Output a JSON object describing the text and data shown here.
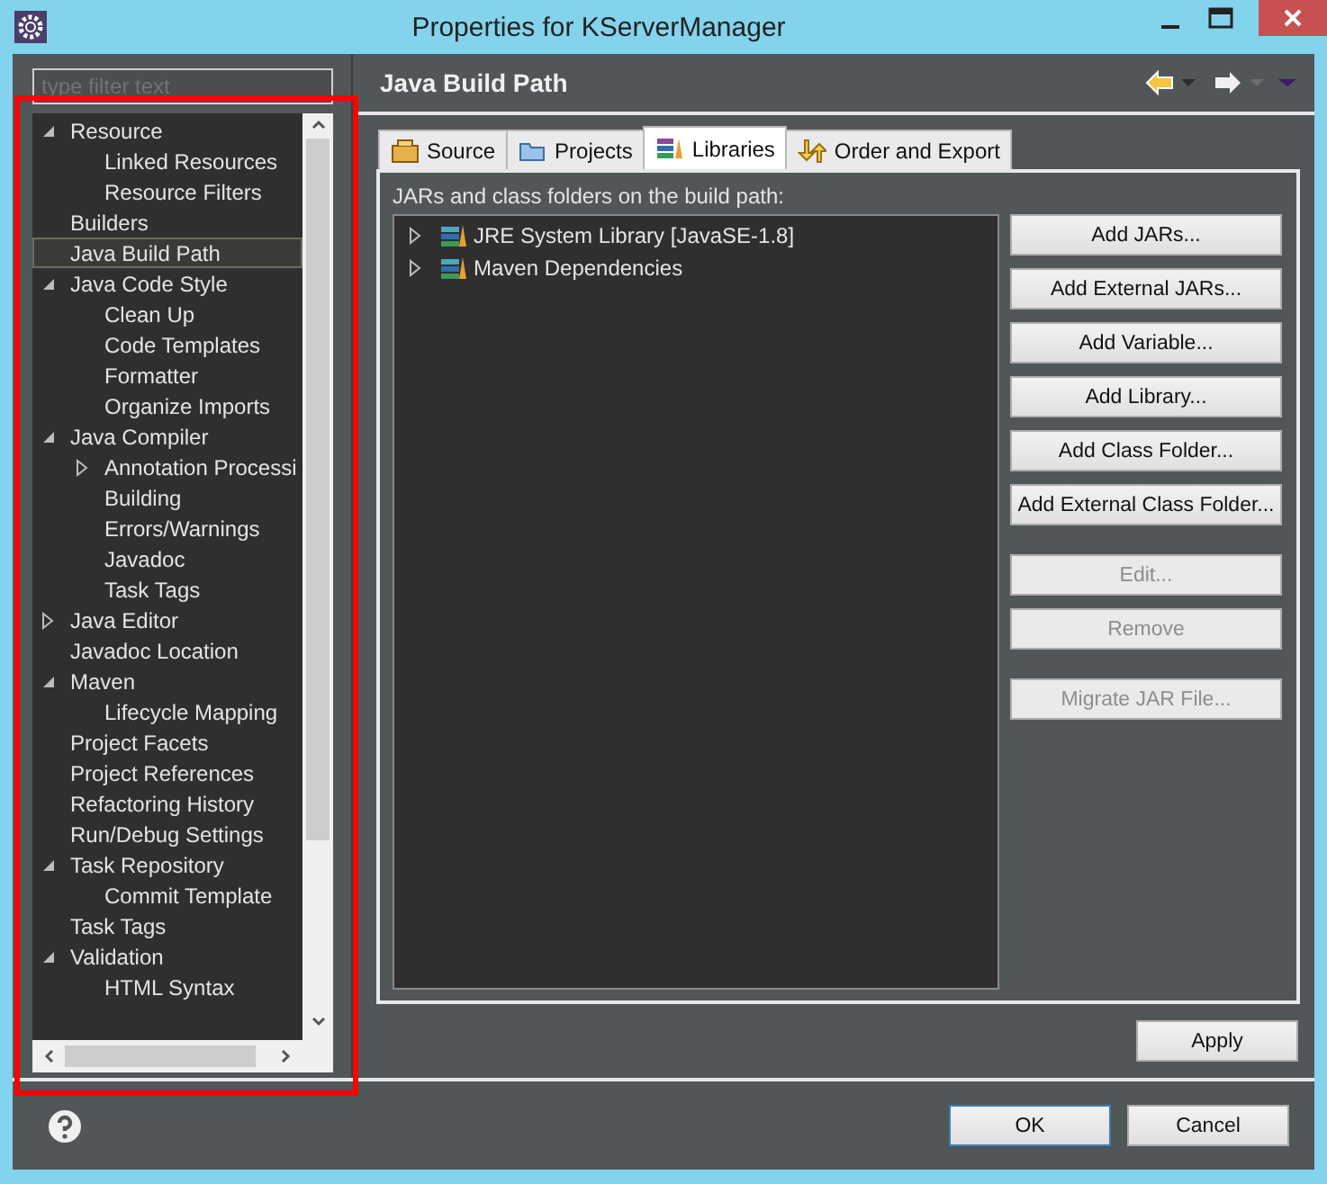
{
  "window": {
    "title": "Properties for KServerManager"
  },
  "filter": {
    "placeholder": "type filter text"
  },
  "tree": [
    {
      "label": "Resource",
      "selected": false,
      "kind": "branch",
      "expanded": true,
      "children": [
        {
          "label": "Linked Resources",
          "selected": false,
          "kind": "leaf"
        },
        {
          "label": "Resource Filters",
          "selected": false,
          "kind": "leaf"
        }
      ]
    },
    {
      "label": "Builders",
      "selected": false,
      "kind": "leaf"
    },
    {
      "label": "Java Build Path",
      "selected": true,
      "kind": "leaf"
    },
    {
      "label": "Java Code Style",
      "selected": false,
      "kind": "branch",
      "expanded": true,
      "children": [
        {
          "label": "Clean Up",
          "selected": false,
          "kind": "leaf"
        },
        {
          "label": "Code Templates",
          "selected": false,
          "kind": "leaf"
        },
        {
          "label": "Formatter",
          "selected": false,
          "kind": "leaf"
        },
        {
          "label": "Organize Imports",
          "selected": false,
          "kind": "leaf"
        }
      ]
    },
    {
      "label": "Java Compiler",
      "selected": false,
      "kind": "branch",
      "expanded": true,
      "children": [
        {
          "label": "Annotation Processi",
          "selected": false,
          "kind": "branch",
          "expanded": false
        },
        {
          "label": "Building",
          "selected": false,
          "kind": "leaf"
        },
        {
          "label": "Errors/Warnings",
          "selected": false,
          "kind": "leaf"
        },
        {
          "label": "Javadoc",
          "selected": false,
          "kind": "leaf"
        },
        {
          "label": "Task Tags",
          "selected": false,
          "kind": "leaf"
        }
      ]
    },
    {
      "label": "Java Editor",
      "selected": false,
      "kind": "branch",
      "expanded": false
    },
    {
      "label": "Javadoc Location",
      "selected": false,
      "kind": "leaf"
    },
    {
      "label": "Maven",
      "selected": false,
      "kind": "branch",
      "expanded": true,
      "children": [
        {
          "label": "Lifecycle Mapping",
          "selected": false,
          "kind": "leaf"
        }
      ]
    },
    {
      "label": "Project Facets",
      "selected": false,
      "kind": "leaf"
    },
    {
      "label": "Project References",
      "selected": false,
      "kind": "leaf"
    },
    {
      "label": "Refactoring History",
      "selected": false,
      "kind": "leaf"
    },
    {
      "label": "Run/Debug Settings",
      "selected": false,
      "kind": "leaf"
    },
    {
      "label": "Task Repository",
      "selected": false,
      "kind": "branch",
      "expanded": true,
      "children": [
        {
          "label": "Commit Template",
          "selected": false,
          "kind": "leaf"
        }
      ]
    },
    {
      "label": "Task Tags",
      "selected": false,
      "kind": "leaf"
    },
    {
      "label": "Validation",
      "selected": false,
      "kind": "branch",
      "expanded": true,
      "children": [
        {
          "label": "HTML Syntax",
          "selected": false,
          "kind": "leaf"
        }
      ]
    }
  ],
  "page": {
    "title": "Java Build Path"
  },
  "tabs": [
    {
      "label": "Source",
      "selected": false,
      "kind": "source"
    },
    {
      "label": "Projects",
      "selected": false,
      "kind": "projects"
    },
    {
      "label": "Libraries",
      "selected": true,
      "kind": "libraries"
    },
    {
      "label": "Order and Export",
      "selected": false,
      "kind": "order"
    }
  ],
  "libraries": {
    "caption": "JARs and class folders on the build path:",
    "entries": [
      {
        "label": "JRE System Library [JavaSE-1.8]",
        "expanded": false
      },
      {
        "label": "Maven Dependencies",
        "expanded": false
      }
    ]
  },
  "button_groups": [
    [
      {
        "label": "Add JARs...",
        "disabled": false
      },
      {
        "label": "Add External JARs...",
        "disabled": false
      },
      {
        "label": "Add Variable...",
        "disabled": false
      },
      {
        "label": "Add Library...",
        "disabled": false
      },
      {
        "label": "Add Class Folder...",
        "disabled": false
      },
      {
        "label": "Add External Class Folder...",
        "disabled": false
      }
    ],
    [
      {
        "label": "Edit...",
        "disabled": true
      },
      {
        "label": "Remove",
        "disabled": true
      }
    ],
    [
      {
        "label": "Migrate JAR File...",
        "disabled": true
      }
    ]
  ],
  "apply_button": {
    "label": "Apply"
  },
  "dialog_buttons": [
    {
      "label": "OK",
      "default": true
    },
    {
      "label": "Cancel",
      "default": false
    }
  ]
}
